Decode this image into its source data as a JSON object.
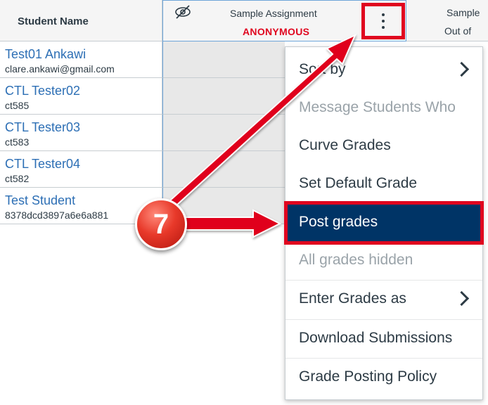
{
  "gradebook": {
    "name_header": "Student Name",
    "assignment": {
      "title": "Sample Assignment",
      "badge": "ANONYMOUS",
      "hidden_icon": "eye-slash-icon",
      "options_icon": "kebab-vertical-icon"
    },
    "next_column": {
      "line1": "Sample",
      "line2": "Out of"
    },
    "students": [
      {
        "name": "Test01 Ankawi",
        "sub": "clare.ankawi@gmail.com"
      },
      {
        "name": "CTL Tester02",
        "sub": "ct585"
      },
      {
        "name": "CTL Tester03",
        "sub": "ct583"
      },
      {
        "name": "CTL Tester04",
        "sub": "ct582"
      },
      {
        "name": "Test Student",
        "sub": "8378dcd3897a6e6a881"
      }
    ]
  },
  "menu": {
    "items": [
      {
        "label": "Sort by",
        "submenu": true,
        "disabled": false
      },
      {
        "label": "Message Students Who",
        "submenu": false,
        "disabled": true
      },
      {
        "label": "Curve Grades",
        "submenu": false,
        "disabled": false
      },
      {
        "label": "Set Default Grade",
        "submenu": false,
        "disabled": false
      },
      {
        "label": "Post grades",
        "submenu": false,
        "disabled": false,
        "active": true
      },
      {
        "label": "All grades hidden",
        "submenu": false,
        "disabled": true
      },
      {
        "label": "Enter Grades as",
        "submenu": true,
        "disabled": false
      },
      {
        "label": "Download Submissions",
        "submenu": false,
        "disabled": false
      },
      {
        "label": "Grade Posting Policy",
        "submenu": false,
        "disabled": false
      }
    ]
  },
  "annotation": {
    "step_number": "7",
    "highlight_color": "#e0061f",
    "active_item_color": "#003466",
    "link_color": "#2d6fb5"
  }
}
